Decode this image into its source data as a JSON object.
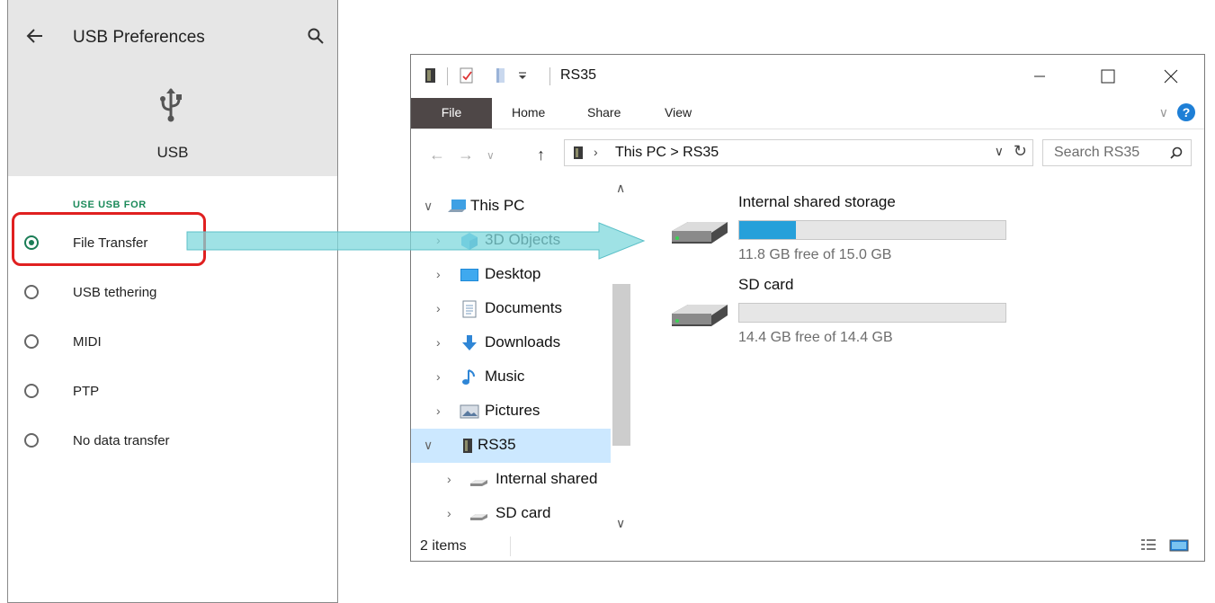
{
  "android": {
    "title": "USB Preferences",
    "usb_label": "USB",
    "section": "USE USB FOR",
    "options": [
      {
        "label": "File Transfer",
        "selected": true
      },
      {
        "label": "USB tethering",
        "selected": false
      },
      {
        "label": "MIDI",
        "selected": false
      },
      {
        "label": "PTP",
        "selected": false
      },
      {
        "label": "No data transfer",
        "selected": false
      }
    ],
    "icons": {
      "back": "arrow-back-icon",
      "search": "search-icon",
      "usb": "usb-icon"
    },
    "accent": "#1b7d56",
    "highlight_color": "#e02020"
  },
  "explorer": {
    "window_title": "RS35",
    "ribbon_tabs": [
      "File",
      "Home",
      "Share",
      "View"
    ],
    "help": "?",
    "address": "This PC  >  RS35",
    "search_placeholder": "Search RS35",
    "nav": [
      {
        "label": "This PC",
        "icon": "this-pc-icon"
      },
      {
        "label": "3D Objects",
        "icon": "3d-objects-icon"
      },
      {
        "label": "Desktop",
        "icon": "desktop-icon"
      },
      {
        "label": "Documents",
        "icon": "documents-icon"
      },
      {
        "label": "Downloads",
        "icon": "downloads-icon"
      },
      {
        "label": "Music",
        "icon": "music-icon"
      },
      {
        "label": "Pictures",
        "icon": "pictures-icon"
      },
      {
        "label": "RS35",
        "icon": "device-icon",
        "selected": true
      },
      {
        "label": "Internal shared",
        "icon": "drive-icon"
      },
      {
        "label": "SD card",
        "icon": "drive-icon"
      }
    ],
    "drives": [
      {
        "name": "Internal shared storage",
        "free": "11.8 GB free of 15.0 GB",
        "used_fraction": 0.213
      },
      {
        "name": "SD card",
        "free": "14.4 GB free of 14.4 GB",
        "used_fraction": 0.0
      }
    ],
    "status": "2 items",
    "accent": "#26a0da",
    "selection_color": "#cce8ff"
  },
  "arrow_color": "#7fd8dc"
}
